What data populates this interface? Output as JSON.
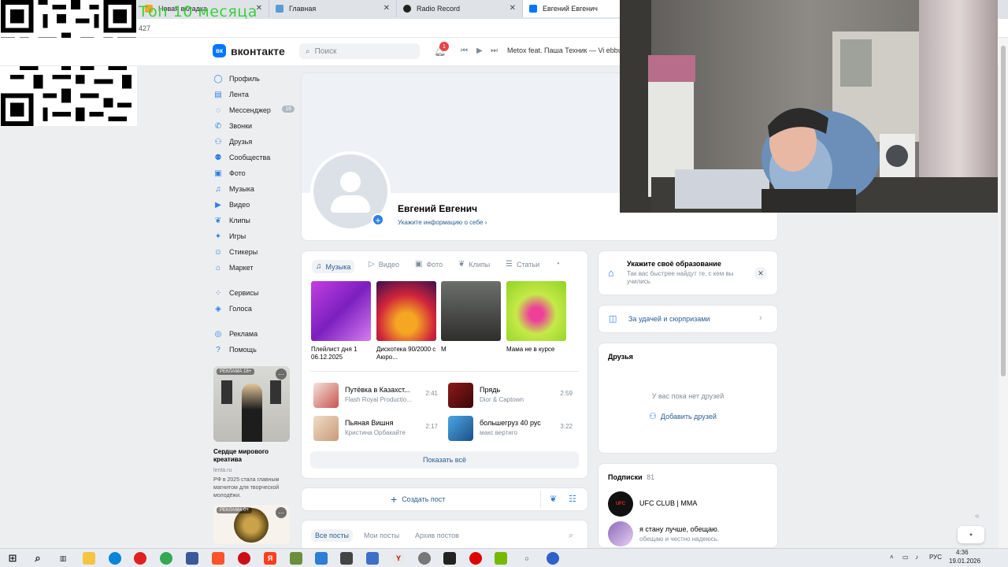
{
  "browser": {
    "tabs": [
      {
        "title": "Новая вкладка",
        "color": "#f5a623"
      },
      {
        "title": "Главная",
        "color": "#5b9bd5"
      },
      {
        "title": "Radio Record",
        "color": "#222222"
      },
      {
        "title": "Евгений Евгенич",
        "color": "#0077ff"
      }
    ],
    "url_fragment": "427"
  },
  "overlay": {
    "stream_title": "Топ 10 месяца"
  },
  "header": {
    "logo_text": "вк",
    "brand": "вконтакте",
    "search_placeholder": "Поиск",
    "notification_count": "1",
    "now_playing": "Metox feat. Паша Техник — Vi ebbu ("
  },
  "nav": {
    "items": [
      {
        "label": "Профиль",
        "icon": "user-icon"
      },
      {
        "label": "Лента",
        "icon": "feed-icon"
      },
      {
        "label": "Мессенджер",
        "icon": "message-icon",
        "badge": "16"
      },
      {
        "label": "Звонки",
        "icon": "phone-icon"
      },
      {
        "label": "Друзья",
        "icon": "friends-icon"
      },
      {
        "label": "Сообщества",
        "icon": "groups-icon"
      },
      {
        "label": "Фото",
        "icon": "photo-icon"
      },
      {
        "label": "Музыка",
        "icon": "music-icon"
      },
      {
        "label": "Видео",
        "icon": "video-icon"
      },
      {
        "label": "Клипы",
        "icon": "clips-icon"
      },
      {
        "label": "Игры",
        "icon": "games-icon"
      },
      {
        "label": "Стикеры",
        "icon": "stickers-icon"
      },
      {
        "label": "Маркет",
        "icon": "market-icon"
      },
      {
        "label": "Сервисы",
        "icon": "services-icon"
      },
      {
        "label": "Голоса",
        "icon": "votes-icon"
      },
      {
        "label": "Реклама",
        "icon": "ads-icon"
      },
      {
        "label": "Помощь",
        "icon": "help-icon"
      }
    ]
  },
  "ads": [
    {
      "label": "РЕКЛАМА 18+",
      "title": "Сердце мирового креатива",
      "domain": "lenta.ru",
      "text": "РФ в 2025 стала главным магнитом для творческой молодёжи."
    },
    {
      "label": "РЕКЛАМА 0+"
    }
  ],
  "profile": {
    "name": "Евгений Евгенич",
    "info_link": "Укажите информацию о себе ›"
  },
  "media": {
    "tabs": [
      "Музыка",
      "Видео",
      "Фото",
      "Клипы",
      "Статьи"
    ],
    "albums": [
      {
        "title": "Плейлист дня 1 06.12.2025"
      },
      {
        "title": "Дискотека 90/2000 с Аюро..."
      },
      {
        "title": "М"
      },
      {
        "title": "Мама не в курсе"
      }
    ],
    "tracks": [
      {
        "title": "Путёвка в Казахст...",
        "artist": "Flash Royal Productio...",
        "duration": "2:41"
      },
      {
        "title": "Прядь",
        "artist": "Dior & Captown",
        "duration": "2:59"
      },
      {
        "title": "Пьяная Вишня",
        "artist": "Кристина Орбакайте",
        "duration": "2:17"
      },
      {
        "title": "большегруз 40 рус",
        "artist": "макс вертиго",
        "duration": "3:22"
      }
    ],
    "show_all": "Показать всё"
  },
  "composer": {
    "create_post": "Создать пост"
  },
  "posts_tabs": [
    "Все посты",
    "Мои посты",
    "Архив постов"
  ],
  "education": {
    "title": "Укажите своё образование",
    "text": "Так вас быстрее найдут те, с кем вы учились"
  },
  "luck": {
    "label": "За удачей и сюрпризами"
  },
  "friends": {
    "title": "Друзья",
    "empty": "У вас пока нет друзей",
    "add": "Добавить друзей"
  },
  "subscriptions": {
    "title": "Подписки",
    "count": "81",
    "items": [
      {
        "name": "UFC CLUB | MMA",
        "sub": ""
      },
      {
        "name": "я стану лучше, обещаю.",
        "sub": "обещаю и честно надеюсь."
      }
    ]
  },
  "taskbar": {
    "lang": "РУС",
    "time": "4:36",
    "date": "19.01.2026"
  }
}
